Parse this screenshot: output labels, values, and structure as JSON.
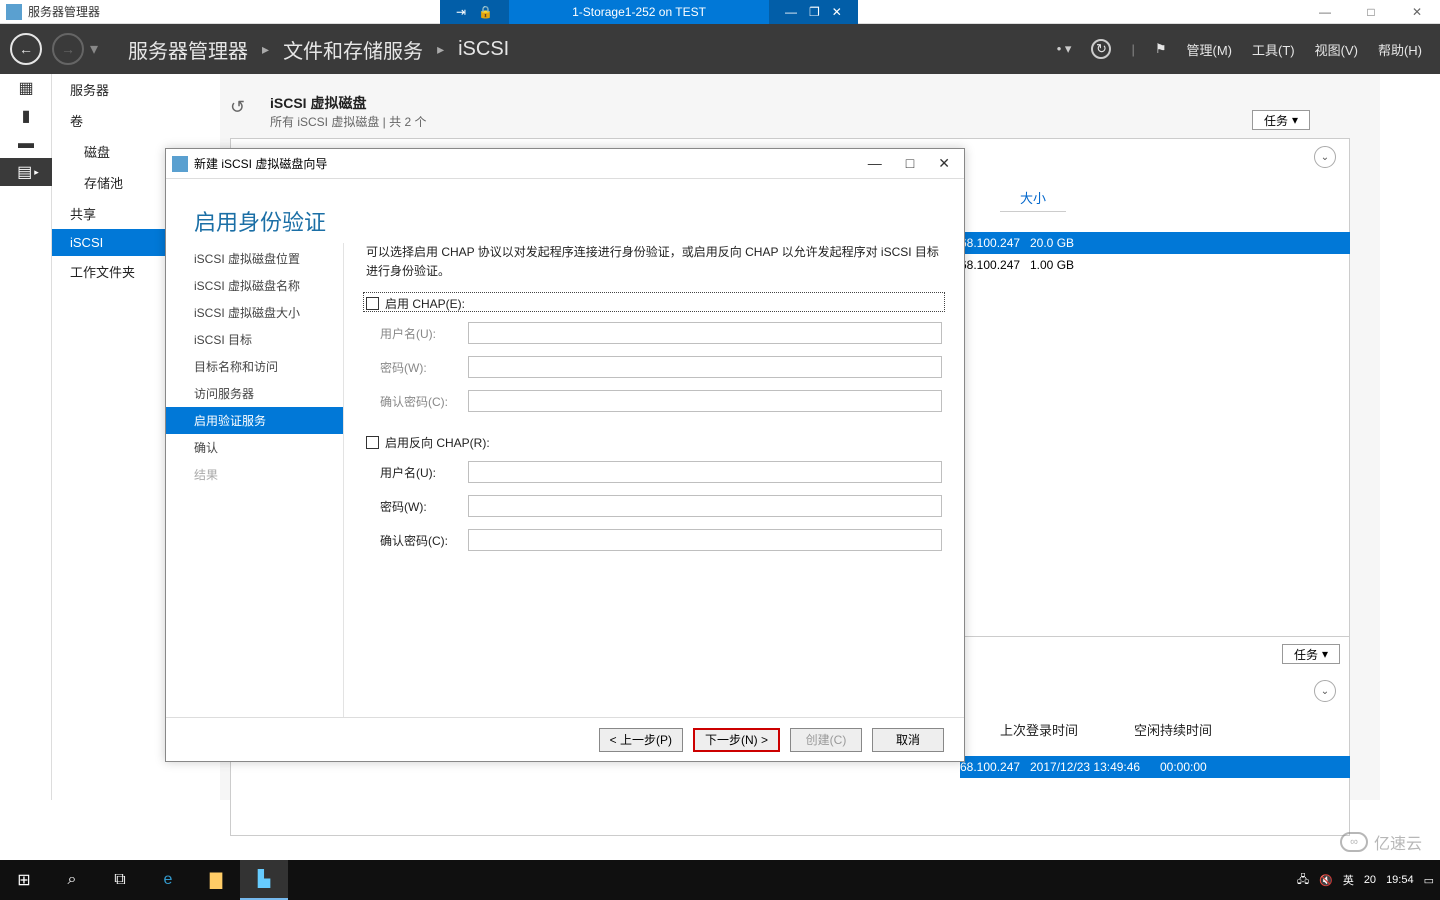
{
  "outerWindow": {
    "title": "服务器管理器",
    "min": "—",
    "max": "□",
    "close": "✕"
  },
  "vmBar": {
    "pin": "⇥",
    "lock": "🔒",
    "title": "1-Storage1-252 on TEST",
    "min": "—",
    "max": "❐",
    "close": "✕"
  },
  "smHeader": {
    "crumbs": [
      "服务器管理器",
      "文件和存储服务",
      "iSCSI"
    ],
    "menu": {
      "manage": "管理(M)",
      "tools": "工具(T)",
      "view": "视图(V)",
      "help": "帮助(H)"
    }
  },
  "leftNav": {
    "servers": "服务器",
    "volumes": "卷",
    "disks": "磁盘",
    "pools": "存储池",
    "shares": "共享",
    "iscsi": "iSCSI",
    "folders": "工作文件夹"
  },
  "iscsiPanel": {
    "title": "iSCSI 虚拟磁盘",
    "subtitle": "所有 iSCSI 虚拟磁盘 | 共 2 个",
    "tasksBtn": "任务",
    "sizeCol": "大小",
    "rows": [
      {
        "ip": "68.100.247",
        "size": "20.0 GB"
      },
      {
        "ip": "68.100.247",
        "size": "1.00 GB"
      }
    ]
  },
  "lowerPanel": {
    "tasksBtn": "任务",
    "col1": "上次登录时间",
    "col2": "空闲持续时间",
    "row": {
      "ip": "68.100.247",
      "login": "2017/12/23 13:49:46",
      "idle": "00:00:00"
    }
  },
  "wizard": {
    "title": "新建 iSCSI 虚拟磁盘向导",
    "heading": "启用身份验证",
    "steps": {
      "loc": "iSCSI 虚拟磁盘位置",
      "name": "iSCSI 虚拟磁盘名称",
      "size": "iSCSI 虚拟磁盘大小",
      "target": "iSCSI 目标",
      "tname": "目标名称和访问",
      "access": "访问服务器",
      "auth": "启用验证服务",
      "confirm": "确认",
      "result": "结果"
    },
    "desc": "可以选择启用 CHAP 协议以对发起程序连接进行身份验证，或启用反向 CHAP 以允许发起程序对 iSCSI 目标进行身份验证。",
    "chap": {
      "enable": "启用 CHAP(E):",
      "user": "用户名(U):",
      "pass": "密码(W):",
      "confirm": "确认密码(C):"
    },
    "rchap": {
      "enable": "启用反向 CHAP(R):",
      "user": "用户名(U):",
      "pass": "密码(W):",
      "confirm": "确认密码(C):"
    },
    "btns": {
      "prev": "< 上一步(P)",
      "next": "下一步(N) >",
      "create": "创建(C)",
      "cancel": "取消"
    }
  },
  "taskbar": {
    "ime": "英",
    "time": "19:54",
    "day": "20"
  },
  "watermark": "亿速云"
}
